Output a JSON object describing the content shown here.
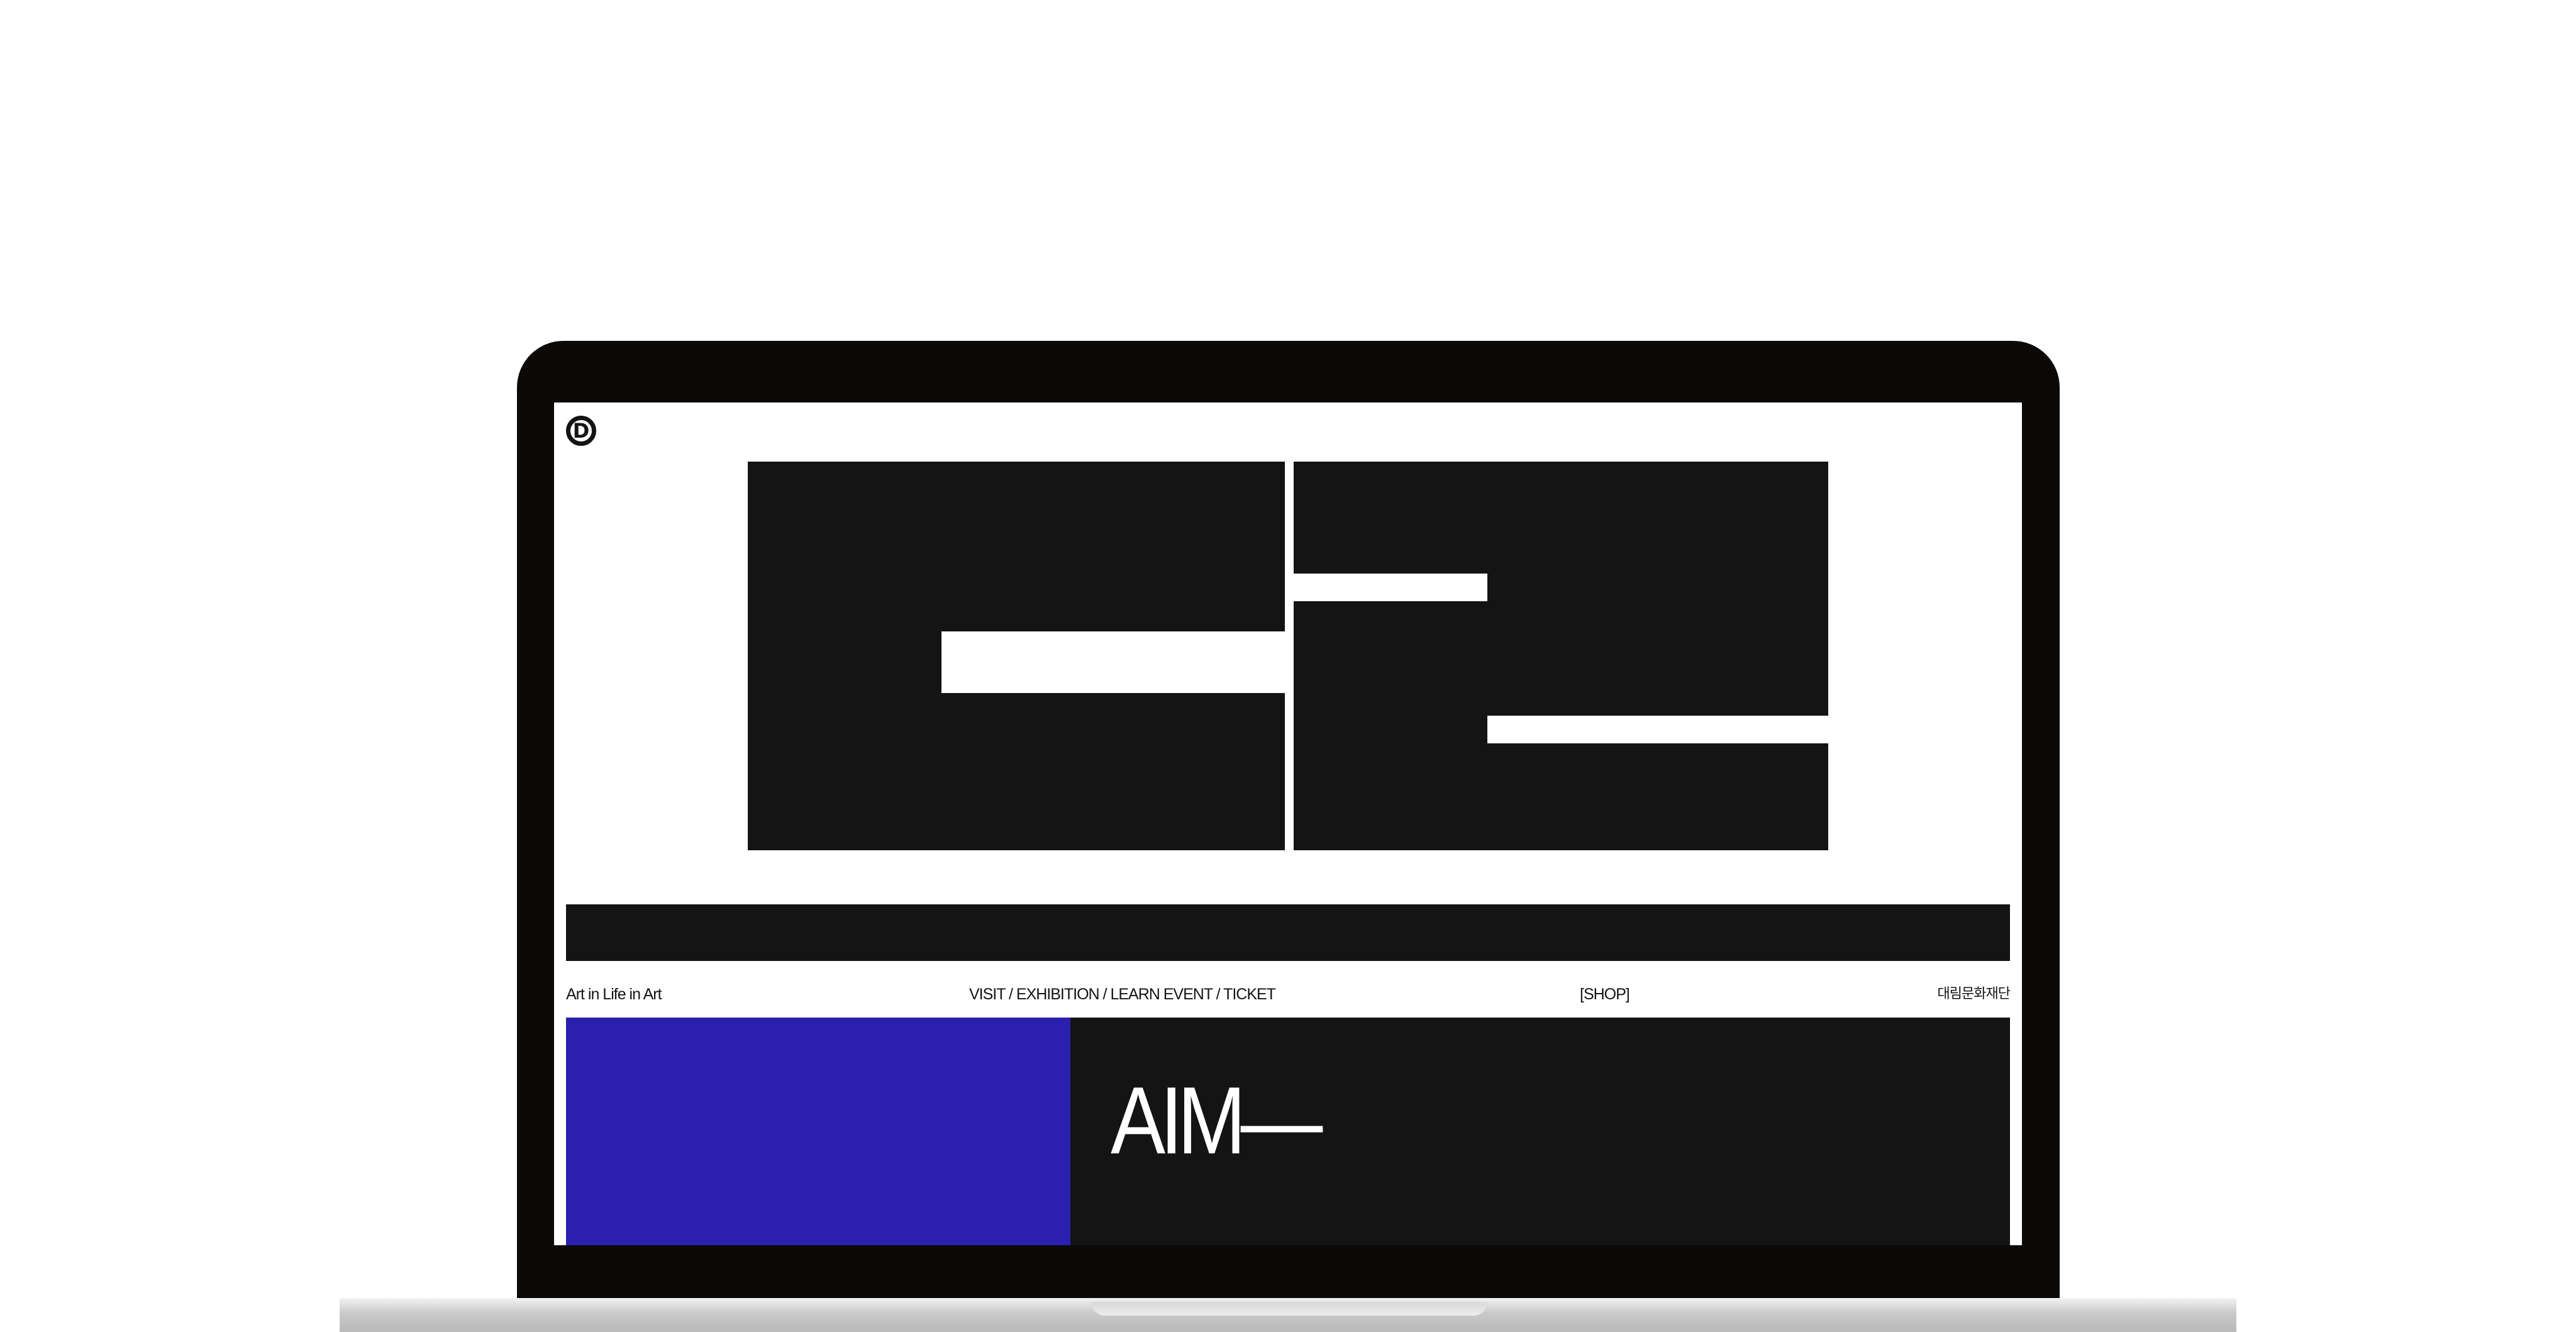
{
  "site": {
    "logo_letter": "D",
    "tagline": "Art in Life in Art",
    "nav": {
      "items": [
        "VISIT",
        "EXHIBITION",
        "LEARN EVENT",
        "TICKET"
      ],
      "separator": " / "
    },
    "shop_label": "[SHOP]",
    "foundation_label": "대림문화재단"
  },
  "feature": {
    "headline": "AIM—"
  },
  "colors": {
    "ink": "#141414",
    "accent_blue": "#2a1fae",
    "laptop_frame": "#0c0909",
    "background": "#ffffff"
  },
  "icons": {
    "logo": "circled-d-logo-icon",
    "hero": "c2-wordmark"
  }
}
